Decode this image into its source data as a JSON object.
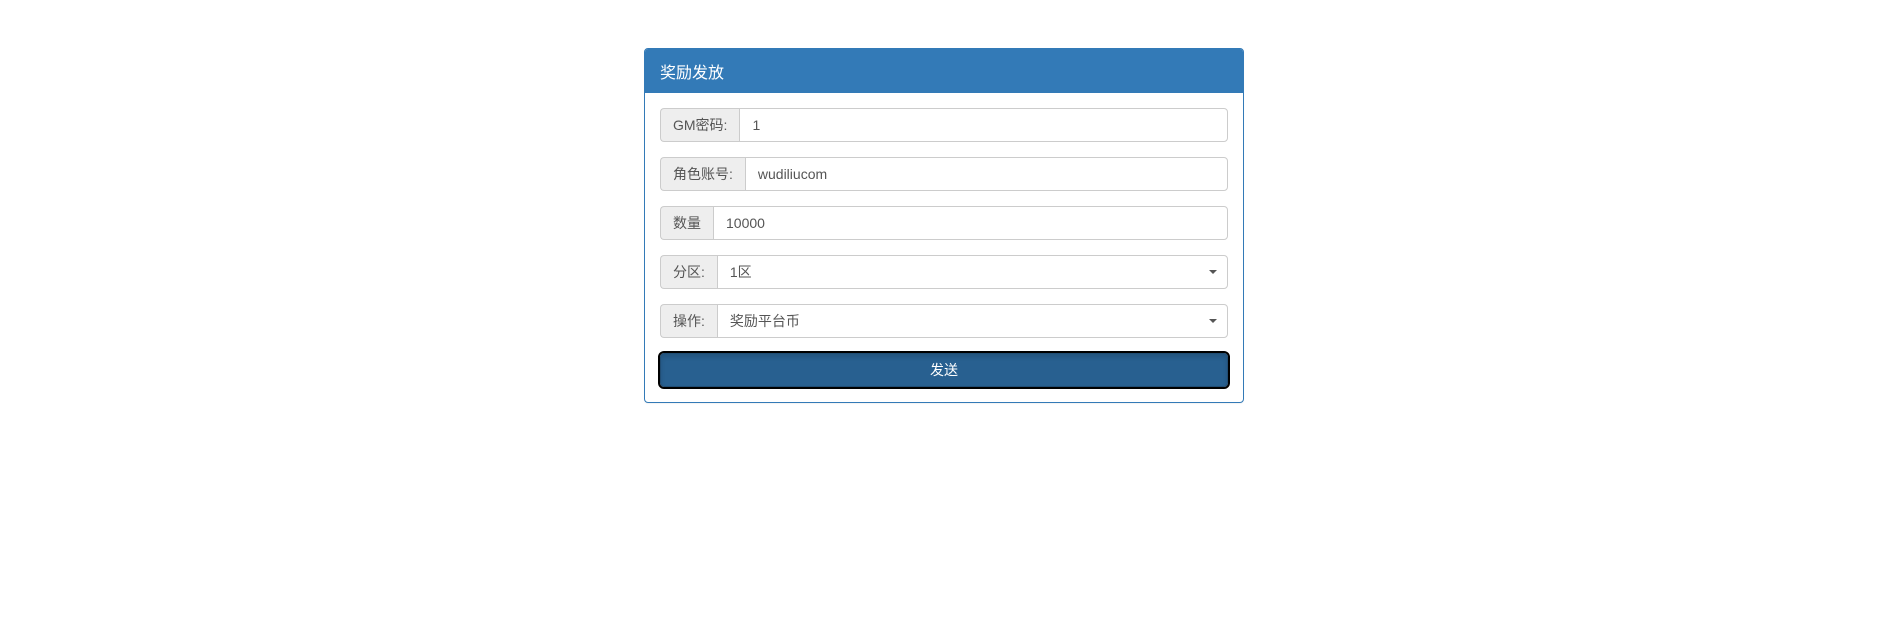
{
  "panel": {
    "title": "奖励发放"
  },
  "form": {
    "gm_password": {
      "label": "GM密码:",
      "value": "1"
    },
    "account": {
      "label": "角色账号:",
      "value": "wudiliucom"
    },
    "amount": {
      "label": "数量",
      "value": "10000"
    },
    "zone": {
      "label": "分区:",
      "selected": "1区"
    },
    "operation": {
      "label": "操作:",
      "selected": "奖励平台币"
    },
    "submit_label": "发送"
  }
}
